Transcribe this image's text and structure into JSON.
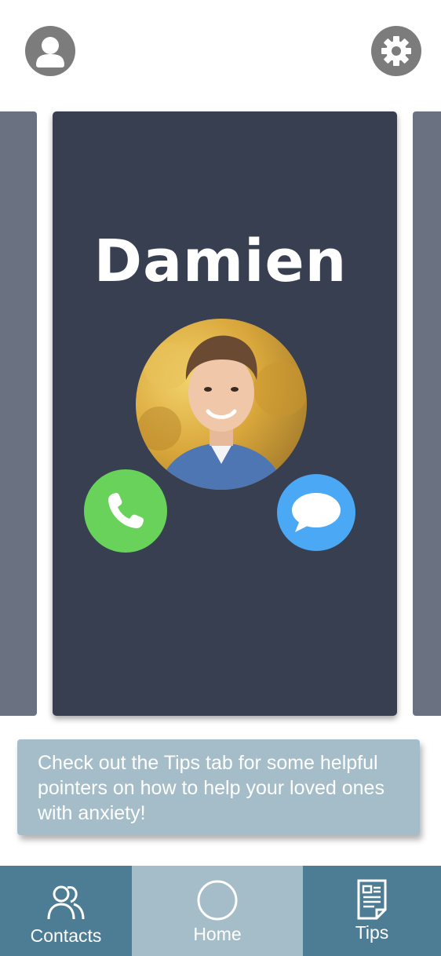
{
  "header": {
    "profile_icon": "person-icon",
    "settings_icon": "gear-icon"
  },
  "contact": {
    "name": "Damien",
    "call_icon": "phone-icon",
    "message_icon": "chat-bubble-icon"
  },
  "banner": {
    "text": "Check out the Tips tab for some helpful pointers on how to help your loved ones with anxiety!"
  },
  "nav": {
    "items": [
      {
        "label": "Contacts",
        "icon": "people-icon"
      },
      {
        "label": "Home",
        "icon": "circle-icon"
      },
      {
        "label": "Tips",
        "icon": "document-icon"
      }
    ]
  },
  "colors": {
    "card": "#373f51",
    "side_card": "#6a7282",
    "call": "#69d25a",
    "message": "#4aa8f5",
    "banner": "#a5bdc9",
    "nav_dark": "#4d7d94",
    "nav_active": "#a5bdc9"
  }
}
